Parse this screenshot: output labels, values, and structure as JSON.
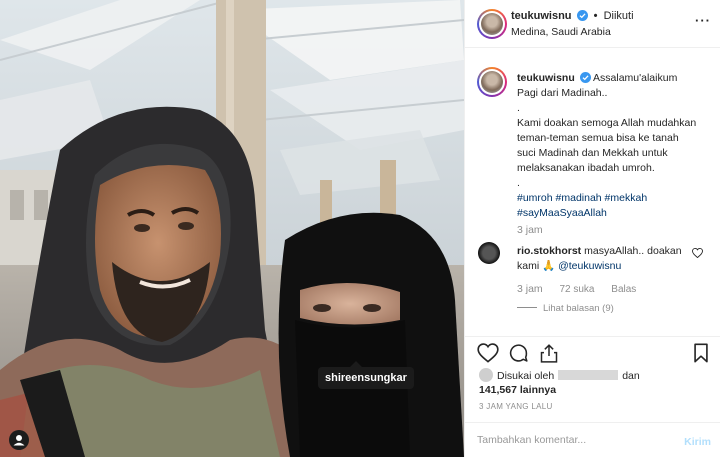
{
  "photo": {
    "tagged_user": "shireensungkar",
    "user_tag_icon": "user-tag-icon"
  },
  "header": {
    "username": "teukuwisnu",
    "separator": "•",
    "follow_status": "Diikuti",
    "location": "Medina, Saudi Arabia",
    "more_icon": "more-options-icon"
  },
  "caption": {
    "username": "teukuwisnu",
    "lines": [
      "Assalamu'alaikum",
      "Pagi dari Madinah..",
      ".",
      "Kami doakan semoga Allah mudahkan",
      "teman-teman semua bisa ke tanah",
      "suci Madinah dan Mekkah untuk",
      "melaksanakan ibadah umroh.",
      "."
    ],
    "hashtags_line1": "#umroh #madinah #mekkah",
    "hashtags_line2": "#sayMaaSyaaAllah",
    "time": "3 jam"
  },
  "comment": {
    "username": "rio.stokhorst",
    "text": "masyaAllah.. doakan kami 🙏",
    "mention": "@teukuwisnu",
    "time": "3 jam",
    "likes": "72 suka",
    "reply": "Balas",
    "view_replies": "Lihat balasan (9)"
  },
  "actions": {
    "like_icon": "heart-icon",
    "comment_icon": "comment-icon",
    "share_icon": "share-icon",
    "save_icon": "bookmark-icon"
  },
  "likes": {
    "prefix": "Disukai oleh",
    "and": "dan",
    "count": "141,567",
    "suffix": "lainnya"
  },
  "time_ago": "3 JAM YANG LALU",
  "add_comment": {
    "placeholder": "Tambahkan komentar...",
    "post_label": "Kirim"
  },
  "colors": {
    "link": "#003569",
    "muted": "#8e8e8e",
    "post_disabled": "#b2dffc",
    "verified": "#3897f0"
  }
}
